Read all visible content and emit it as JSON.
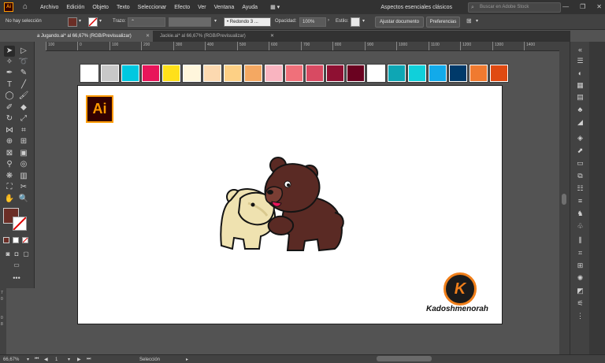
{
  "app": {
    "logo_text": "Ai"
  },
  "menu": [
    "Archivo",
    "Edición",
    "Objeto",
    "Texto",
    "Seleccionar",
    "Efecto",
    "Ver",
    "Ventana",
    "Ayuda"
  ],
  "workspace": "Aspectos esenciales clásicos",
  "stock_search": {
    "placeholder": "Buscar en Adobe Stock"
  },
  "control": {
    "selection": "No hay selección",
    "fill_color": "#6b2e26",
    "stroke_label": "Trazo:",
    "brush": "Redondo 3 ...",
    "opacity_label": "Opacidad:",
    "opacity_value": "100%",
    "style_label": "Estilo:",
    "doc_setup": "Ajustar documento",
    "prefs": "Preferencias"
  },
  "tabs": [
    {
      "label": "a Jugando.ai* al 66,67% (RGB/Previsualizar)",
      "active": true
    },
    {
      "label": "Jackie.ai* al 66,67% (RGB/Previsualizar)",
      "active": false
    }
  ],
  "ruler": {
    "top_ticks": [
      "100",
      "0",
      "100",
      "200",
      "300",
      "400",
      "500",
      "600",
      "700",
      "800",
      "900",
      "1000",
      "1100",
      "1200",
      "1300",
      "1400"
    ],
    "left_ticks": [
      "7",
      "0",
      "0",
      "8"
    ]
  },
  "swatches": [
    "#ffffff",
    "#c8c8c8",
    "#00c8e0",
    "#e8155a",
    "#ffe01a",
    "#fff6dc",
    "#fcd9b0",
    "#fdd085",
    "#f4a862",
    "#f9b4c0",
    "#f0707a",
    "#d84a62",
    "#8e1032",
    "#6a0220",
    "#ffffff",
    "#0ea6b4",
    "#10d0da",
    "#12aaea",
    "#003a6a",
    "#f07a30",
    "#e04a12"
  ],
  "artwork": {
    "ai_badge": "Ai",
    "k_badge": "K",
    "brand": "Kadoshmenorah"
  },
  "colors": {
    "bear_brown": "#5a2a24",
    "bear_brown_light": "#7a3e34",
    "bear_cream": "#efe2b0",
    "bear_cream_shade": "#d9c98f",
    "stroke": "#141414"
  },
  "status": {
    "zoom": "66,67%",
    "artboard": "1",
    "tool": "Selección"
  }
}
